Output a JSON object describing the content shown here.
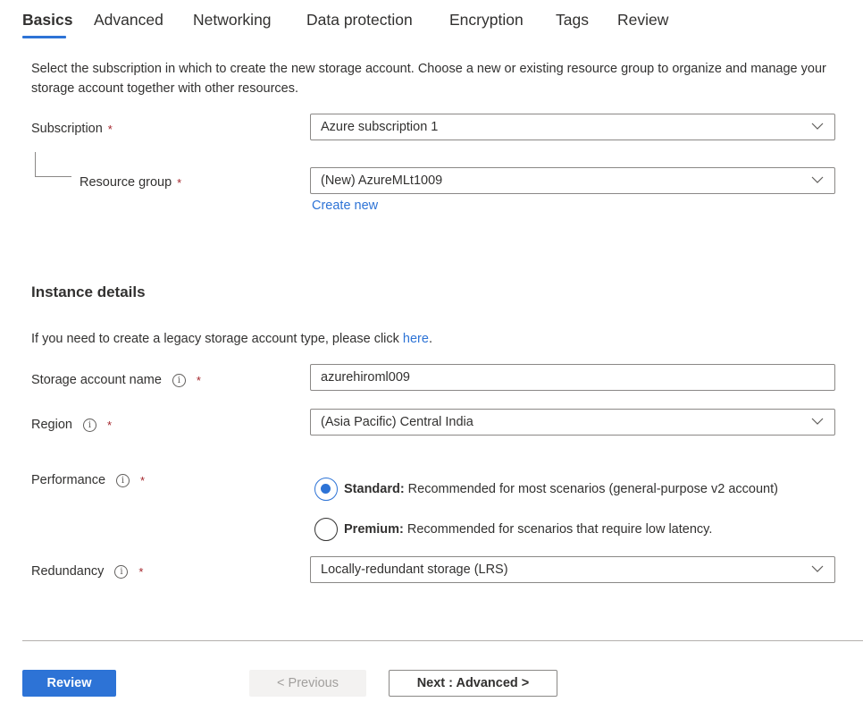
{
  "tabs": [
    {
      "label": "Basics",
      "active": true
    },
    {
      "label": "Advanced",
      "active": false
    },
    {
      "label": "Networking",
      "active": false
    },
    {
      "label": "Data protection",
      "active": false
    },
    {
      "label": "Encryption",
      "active": false
    },
    {
      "label": "Tags",
      "active": false
    },
    {
      "label": "Review",
      "active": false
    }
  ],
  "intro_text": "Select the subscription in which to create the new storage account. Choose a new or existing resource group to organize and manage your storage account together with other resources.",
  "project": {
    "subscription": {
      "label": "Subscription",
      "required": "*",
      "value": "Azure subscription 1"
    },
    "resource_group": {
      "label": "Resource group",
      "required": "*",
      "value": "(New) AzureMLt1009",
      "create_new": "Create new"
    }
  },
  "instance": {
    "title": "Instance details",
    "legacy_text": "If you need to create a legacy storage account type, please click ",
    "legacy_link": "here",
    "legacy_end": ".",
    "storage_name": {
      "label": "Storage account name",
      "required": "*",
      "value": "azurehiroml009"
    },
    "region": {
      "label": "Region",
      "required": "*",
      "value": "(Asia Pacific) Central India"
    },
    "performance": {
      "label": "Performance",
      "required": "*",
      "options": [
        {
          "name": "Standard:",
          "desc": "Recommended for most scenarios (general-purpose v2 account)",
          "checked": true
        },
        {
          "name": "Premium:",
          "desc": "Recommended for scenarios that require low latency.",
          "checked": false
        }
      ]
    },
    "redundancy": {
      "label": "Redundancy",
      "required": "*",
      "value": "Locally-redundant storage (LRS)"
    }
  },
  "icons": {
    "info": "i"
  },
  "footer": {
    "review": "Review",
    "previous": "< Previous",
    "next": "Next : Advanced >"
  },
  "colors": {
    "accent": "#2d73d6",
    "required": "#a4262c",
    "text": "#323130"
  }
}
